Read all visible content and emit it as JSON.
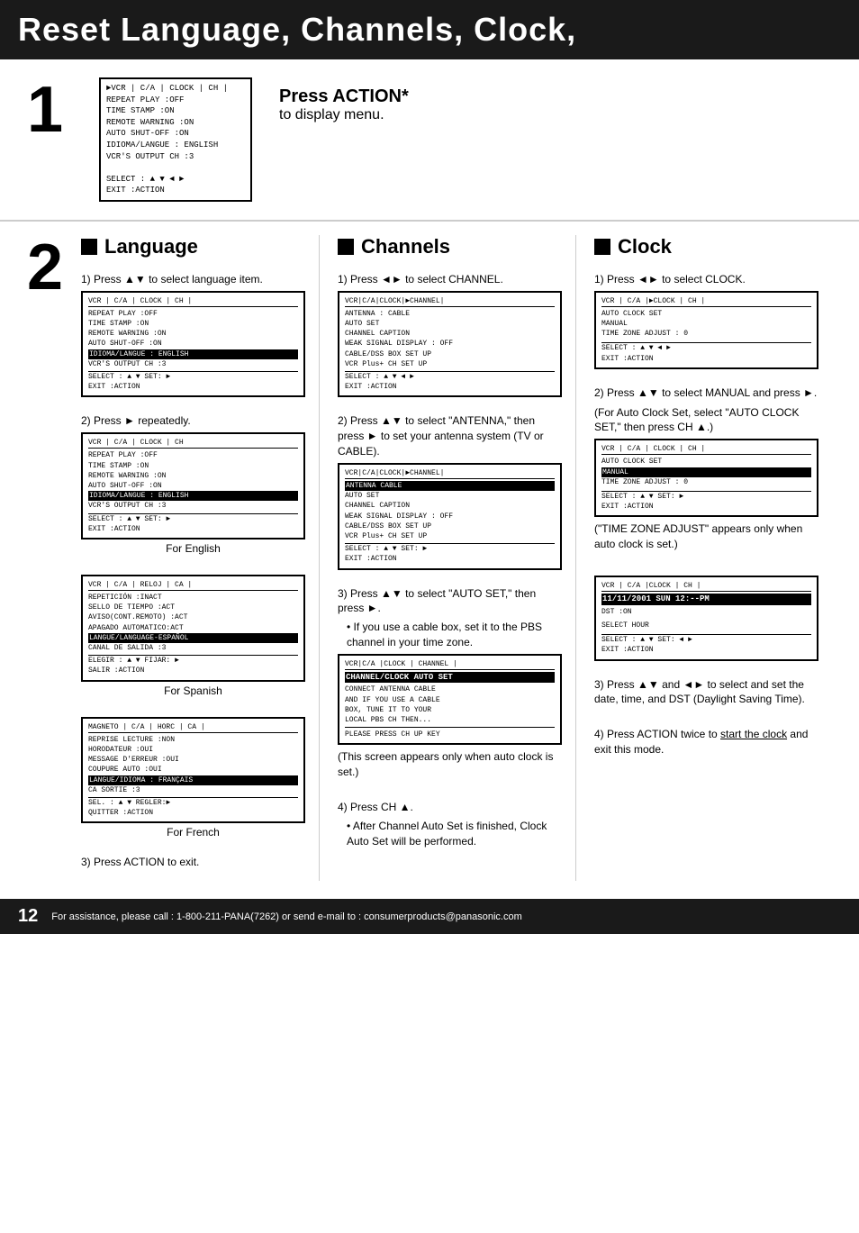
{
  "header": {
    "title": "Reset Language, Channels, Clock,"
  },
  "step1": {
    "number": "1",
    "press_action": "Press ACTION*",
    "sub_text": "to display menu.",
    "screen": {
      "title": "►VCR  | C/A | CLOCK  | CH |",
      "rows": [
        "REPEAT PLAY     :OFF",
        "TIME STAMP      :ON",
        "REMOTE WARNING  :ON",
        "AUTO SHUT-OFF   :ON",
        "IDIOMA/LANGUE : ENGLISH",
        "VCR'S OUTPUT CH  :3",
        "",
        "SELECT : ▲ ▼ ◄ ►",
        "EXIT    :ACTION"
      ]
    }
  },
  "step2": {
    "number": "2",
    "language": {
      "title": "Language",
      "step1_text": "1) Press ▲▼ to select language item.",
      "screen1": {
        "title": "VCR  | C/A | CLOCK  | CH |",
        "rows": [
          "REPEAT PLAY     :OFF",
          "TIME STAMP      :ON",
          "REMOTE WARNING  :ON",
          "AUTO SHUT-OFF   :ON",
          "IDIOMA/LANGUE : ENGLISH",
          "VCR'S OUTPUT CH  :3"
        ],
        "footer": "SELECT : ▲ ▼    SET: ►\nEXIT    :ACTION"
      },
      "step2_text": "2) Press ► repeatedly.",
      "screen2": {
        "title": "VCR  | C/A | CLOCK  |  CH",
        "rows": [
          "REPEAT PLAY     :OFF",
          "TIME STAMP      :ON",
          "REMOTE WARNING  :ON",
          "AUTO SHUT-OFF   :ON",
          "IDIOMA/LANGUE : ENGLISH",
          "VCR'S OUTPUT CH  :3"
        ],
        "footer": "SELECT : ▲ ▼    SET: ►\nEXIT    :ACTION"
      },
      "label_english": "For English",
      "screen3": {
        "title": "VCR  | C/A | RELOJ |  CA |",
        "rows": [
          "REPETICIÓN      :INACT",
          "SELLO DE TIEMPO :ACT",
          "AVISO(CONT.REMOTO) :ACT",
          "APAGADO AUTOMATICO:ACT",
          "LANGUE/LANGUAGE-ESPAÑOL",
          "CANAL DE SALIDA  :3",
          "",
          "ELEGIR : ▲ ▼   FIJAR: ►",
          "SALIR   :ACTION"
        ]
      },
      "label_spanish": "For Spanish",
      "screen4": {
        "title": "MAGNETO | C/A | HORC | CA |",
        "rows": [
          "REPRISE LECTURE    :NON",
          "HORODATEUR         :OUI",
          "MESSAGE D'ERREUR   :OUI",
          "COUPURE AUTO       :OUI",
          "LANGUE/IDIOMA : FRANÇAIS",
          "CA SORTIE  :3",
          "",
          "SEL.   : ▲ ▼  REGLER:►",
          "QUITTER :ACTION"
        ]
      },
      "label_french": "For French",
      "step3_text": "3) Press ACTION to exit."
    },
    "channels": {
      "title": "Channels",
      "step1_text": "1) Press ◄► to select CHANNEL.",
      "screen1": {
        "title": "VCR|C/A |CLOCK |►CHANNEL|",
        "rows": [
          "ANTENNA : CABLE",
          "AUTO SET",
          "CHANNEL CAPTION",
          "WEAK SIGNAL DISPLAY : OFF",
          "CABLE/DSS BOX SET UP",
          "VCR Plus+ CH SET UP"
        ],
        "footer": "SELECT : ▲ ▼ ◄ ►\nEXIT    :ACTION"
      },
      "step2_text": "2) Press ▲▼ to select \"ANTENNA,\" then press ► to set your antenna system (TV or CABLE).",
      "screen2": {
        "title": "VCR|C/A |CLOCK |►CHANNEL|",
        "rows": [
          "ANTENNA   CABLE",
          "AUTO SET",
          "CHANNEL CAPTION",
          "WEAK SIGNAL DISPLAY : OFF",
          "CABLE/DSS BOX SET UP",
          "VCR Plus+ CH SET UP"
        ],
        "footer": "SELECT : ▲ ▼    SET: ►\nEXIT    :ACTION"
      },
      "step3_text": "3) Press ▲▼ to select \"AUTO SET,\" then press ►.",
      "bullet3": "If you use a cable box, set it to the PBS channel in your time zone.",
      "screen3": {
        "title": "VCR|C/A |CLOCK | CHANNEL |",
        "highlight": "CHANNEL/CLOCK AUTO SET",
        "rows": [
          "CONNECT ANTENNA CABLE",
          "AND IF YOU USE A CABLE",
          "BOX, TUNE IT TO YOUR",
          "LOCAL PBS CH    THEN...",
          "",
          "PLEASE PRESS CH UP KEY"
        ]
      },
      "note3": "(This screen appears only when auto clock is set.)",
      "step4_text": "4) Press CH ▲.",
      "bullet4": "After Channel Auto Set is finished, Clock Auto Set will be performed."
    },
    "clock": {
      "title": "Clock",
      "step1_text": "1) Press ◄► to select CLOCK.",
      "screen1": {
        "title": "VCR  | C/A |►CLOCK |  CH |",
        "rows": [
          "AUTO CLOCK SET",
          "MANUAL",
          "TIME ZONE ADJUST : 0"
        ],
        "footer": "SELECT : ▲ ▼ ◄ ►\nEXIT    :ACTION"
      },
      "step2_text": "2) Press ▲▼ to select MANUAL and press ►.",
      "step2_note": "(For Auto Clock Set, select \"AUTO CLOCK SET,\" then press CH ▲.)",
      "screen2": {
        "title": "VCR  | C/A  | CLOCK |  CH |",
        "rows": [
          "AUTO CLOCK SET",
          "MANUAL",
          "TIME ZONE ADJUST : 0"
        ],
        "footer": "SELECT : ▲ ▼    SET: ►\nEXIT    :ACTION"
      },
      "time_zone_note": "(\"TIME ZONE ADJUST\" appears only when auto clock is set.)",
      "screen3": {
        "title": "VCR  | C/A  |CLOCK |  CH |",
        "highlight": "11/11/2001 SUN 12:--PM",
        "rows": [
          "DST :ON",
          "",
          "SELECT HOUR"
        ],
        "footer": "SELECT : ▲ ▼    SET: ◄ ►\nEXIT    :ACTION"
      },
      "step3_text": "3) Press ▲▼ and ◄► to select and set the date, time, and DST (Daylight Saving Time).",
      "step4_text": "4) Press ACTION twice to",
      "step4_link": "start the clock",
      "step4_end": " and exit this mode."
    }
  },
  "footer": {
    "page_number": "12",
    "text": "For assistance, please call : 1-800-211-PANA(7262) or send e-mail to : consumerproducts@panasonic.com"
  }
}
